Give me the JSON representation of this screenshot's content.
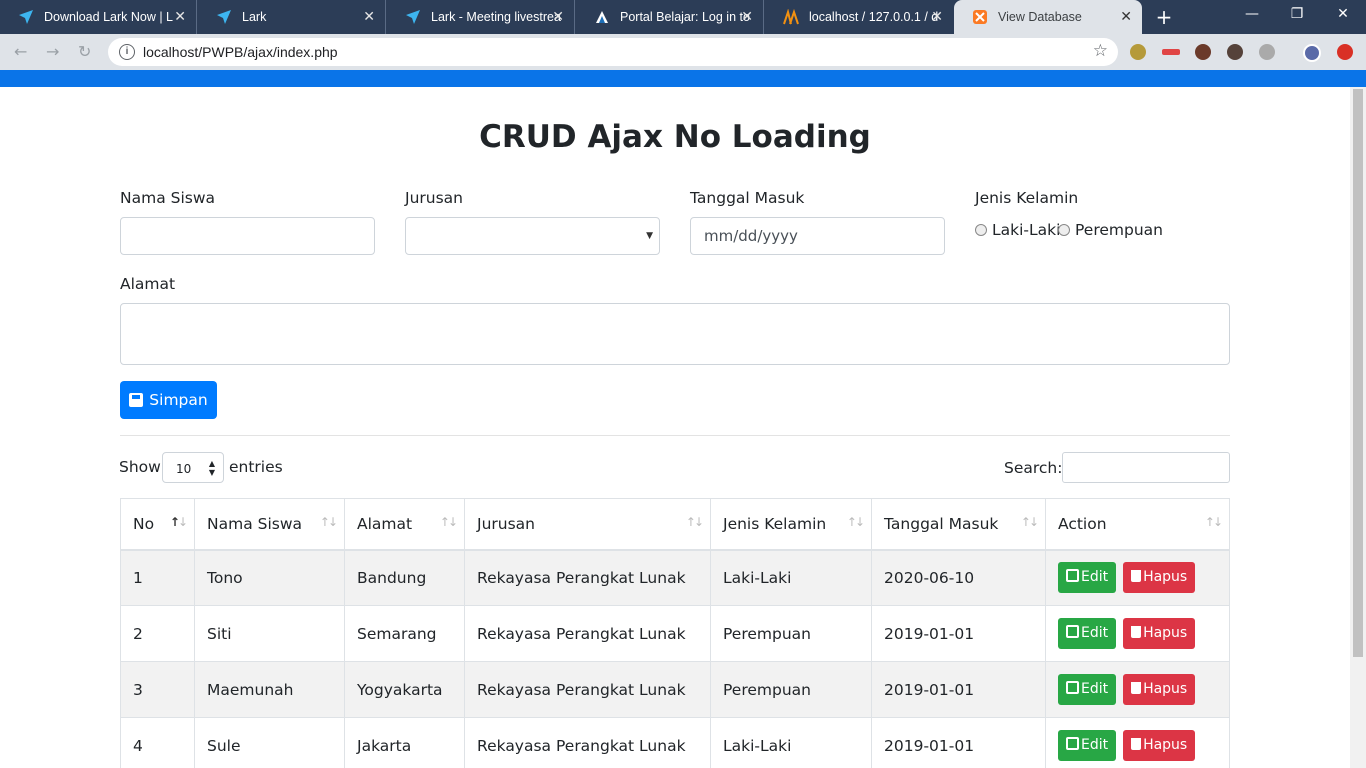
{
  "browser": {
    "tabs": [
      {
        "title": "Download Lark Now | L",
        "icon": "lark-icon"
      },
      {
        "title": "Lark",
        "icon": "lark-icon"
      },
      {
        "title": "Lark - Meeting livestrea",
        "icon": "lark-icon"
      },
      {
        "title": "Portal Belajar: Log in to",
        "icon": "moodle-icon"
      },
      {
        "title": "localhost / 127.0.0.1 / d",
        "icon": "phpmyadmin-icon"
      },
      {
        "title": "View Database",
        "icon": "xampp-icon"
      }
    ],
    "url": "localhost/PWPB/ajax/index.php"
  },
  "page": {
    "title": "CRUD Ajax No Loading",
    "form": {
      "nama_label": "Nama Siswa",
      "jurusan_label": "Jurusan",
      "tanggal_label": "Tanggal Masuk",
      "tanggal_placeholder": "mm/dd/yyyy",
      "jk_label": "Jenis Kelamin",
      "jk_options": [
        "Laki-Laki",
        "Perempuan"
      ],
      "alamat_label": "Alamat",
      "save_label": "Simpan"
    },
    "table_controls": {
      "show_label": "Show",
      "length_value": "10",
      "entries_label": "entries",
      "search_label": "Search:"
    },
    "table": {
      "headers": [
        "No",
        "Nama Siswa",
        "Alamat",
        "Jurusan",
        "Jenis Kelamin",
        "Tanggal Masuk",
        "Action"
      ],
      "rows": [
        [
          "1",
          "Tono",
          "Bandung",
          "Rekayasa Perangkat Lunak",
          "Laki-Laki",
          "2020-06-10"
        ],
        [
          "2",
          "Siti",
          "Semarang",
          "Rekayasa Perangkat Lunak",
          "Perempuan",
          "2019-01-01"
        ],
        [
          "3",
          "Maemunah",
          "Yogyakarta",
          "Rekayasa Perangkat Lunak",
          "Perempuan",
          "2019-01-01"
        ],
        [
          "4",
          "Sule",
          "Jakarta",
          "Rekayasa Perangkat Lunak",
          "Laki-Laki",
          "2019-01-01"
        ]
      ],
      "edit_label": "Edit",
      "delete_label": "Hapus"
    }
  },
  "colors": {
    "primary": "#007bff",
    "success": "#28a745",
    "danger": "#dc3545",
    "topbar": "#0a74e8"
  }
}
